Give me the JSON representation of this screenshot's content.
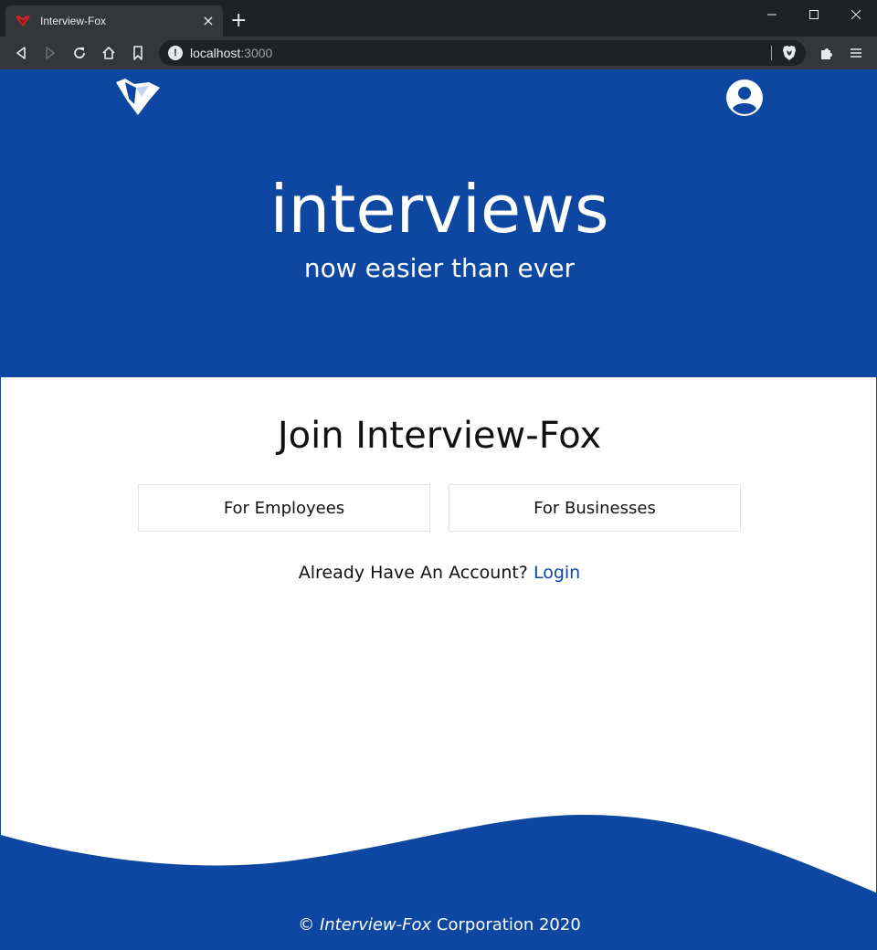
{
  "browser": {
    "tab_title": "Interview-Fox",
    "new_tab_label": "+",
    "tab_close_label": "×",
    "url_host": "localhost",
    "url_port": ":3000"
  },
  "hero": {
    "title": "interviews",
    "subtitle": "now easier than ever"
  },
  "join": {
    "title": "Join Interview-Fox",
    "employees_label": "For Employees",
    "businesses_label": "For Businesses",
    "already_text": "Already Have An Account?",
    "login_label": "Login"
  },
  "footer": {
    "copyright_symbol": "©",
    "brand": "Interview-Fox",
    "rest": "Corporation 2020"
  },
  "colors": {
    "brand_blue": "#0e47a1",
    "chrome_dark": "#202124",
    "chrome_toolbar": "#35363a"
  },
  "icons": {
    "favicon": "fox-icon",
    "logo": "fox-logo-icon",
    "account": "account-circle-icon"
  }
}
